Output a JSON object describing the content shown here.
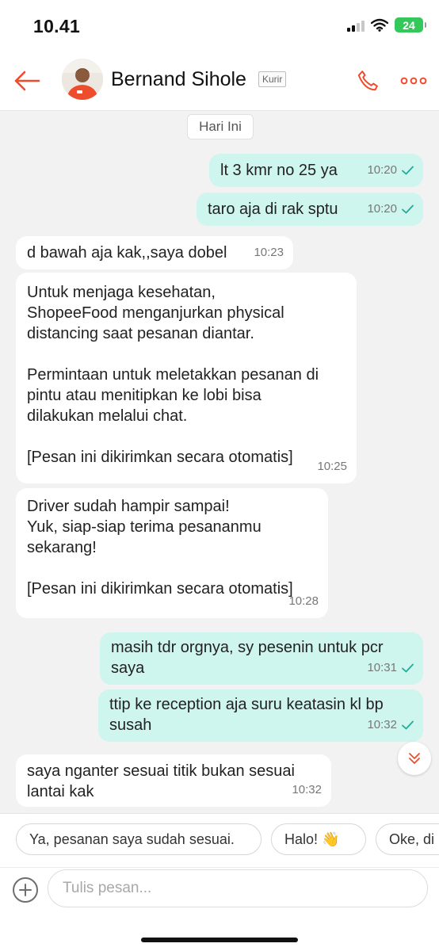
{
  "status": {
    "time": "10.41",
    "battery": "24"
  },
  "header": {
    "name": "Bernand Sihole",
    "role": "Kurir"
  },
  "chat": {
    "date_label": "Hari Ini",
    "messages": [
      {
        "dir": "out",
        "text": "lt 3 kmr no 25 ya",
        "time": "10:20",
        "read": true
      },
      {
        "dir": "out",
        "text": "taro aja di rak sptu",
        "time": "10:20",
        "read": true
      },
      {
        "dir": "in",
        "text": "d bawah aja kak,,saya dobel",
        "time": "10:23"
      },
      {
        "dir": "in",
        "text": "Untuk menjaga kesehatan,\nShopeeFood menganjurkan physical\ndistancing saat pesanan diantar.\n\nPermintaan untuk meletakkan pesanan di\npintu atau menitipkan ke lobi bisa\ndilakukan melalui chat.\n\n[Pesan ini dikirimkan secara otomatis]",
        "time": "10:25"
      },
      {
        "dir": "in",
        "text": "Driver sudah hampir sampai!\nYuk, siap-siap terima pesananmu\nsekarang!\n\n[Pesan ini dikirimkan secara otomatis]",
        "time": "10:28"
      },
      {
        "dir": "out",
        "text": "masih tdr orgnya, sy pesenin untuk pcr\nsaya",
        "time": "10:31",
        "read": true
      },
      {
        "dir": "out",
        "text": "ttip ke reception aja suru keatasin kl bp\nsusah",
        "time": "10:32",
        "read": true
      },
      {
        "dir": "in",
        "text": "saya nganter sesuai titik bukan sesuai\nlantai kak",
        "time": "10:32"
      }
    ]
  },
  "quick_replies": [
    "Ya, pesanan saya sudah sesuai.",
    "Halo! 👋",
    "Oke, di"
  ],
  "composer": {
    "placeholder": "Tulis pesan..."
  },
  "colors": {
    "accent": "#ee4d2d",
    "outgoing_bubble": "#cff5ef",
    "read_check": "#26aa99",
    "battery": "#34c759"
  }
}
